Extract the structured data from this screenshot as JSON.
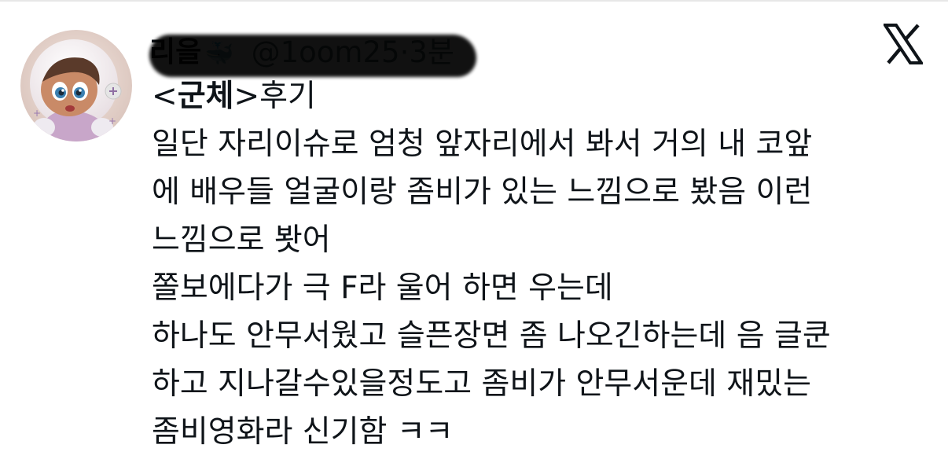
{
  "tweet": {
    "author": {
      "display_name": "리을",
      "name_emoji": "🐳",
      "handle": "@1oom25",
      "separator": "·",
      "time": "3분"
    },
    "title": {
      "open": "<",
      "bold": "군체",
      "close": ">",
      "after": "후기"
    },
    "lines": [
      "일단 자리이슈로 엄청 앞자리에서 봐서 거의 내 코앞",
      "에 배우들 얼굴이랑 좀비가 있는 느낌으로 봤음 이런",
      "느낌으로 봣어",
      "쫄보에다가 극 F라 울어 하면 우는데",
      "하나도 안무서웠고 슬픈장면 좀 나오긴하는데 음 글쿤",
      "하고 지나갈수있을정도고 좀비가 안무서운데 재밌는",
      "좀비영화라 신기함 ㅋㅋ"
    ]
  },
  "icons": {
    "brand": "x-logo-icon",
    "avatar": "avatar-image"
  },
  "colors": {
    "text": "#0f1419",
    "secondary": "#536471",
    "background": "#ffffff"
  }
}
